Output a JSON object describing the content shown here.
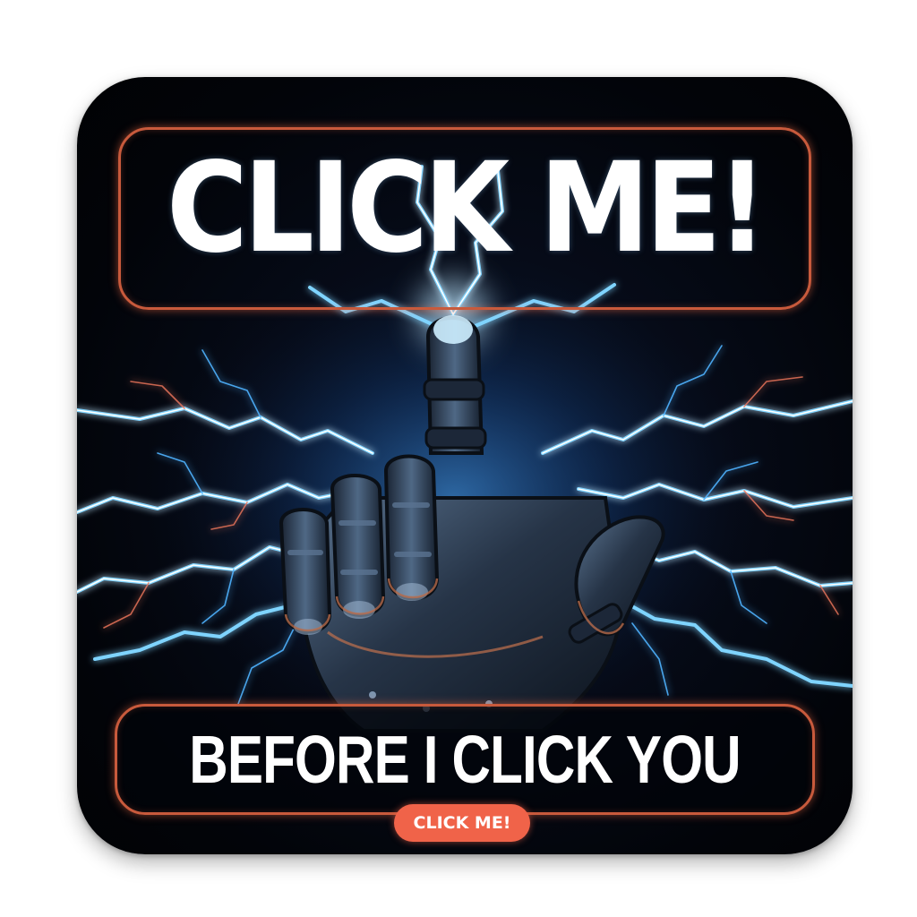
{
  "sticker": {
    "headline": "CLICK ME!",
    "subheadline": "BEFORE I CLICK YOU",
    "button_label": "CLICK ME!"
  },
  "palette": {
    "background": "#02040a",
    "frame_glow": "#c85a3c",
    "lightning": "#7fd4ff",
    "button": "#f06349",
    "glove": "#243041"
  },
  "icons": [
    "robotic-hand-icon",
    "lightning-icon"
  ]
}
